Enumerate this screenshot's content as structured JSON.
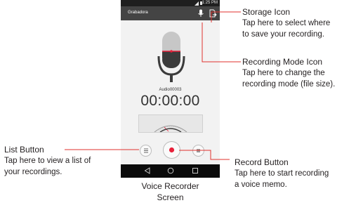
{
  "phone": {
    "status_time": "1:25 PM",
    "app_title": "Grabadora",
    "file_name": "Audio00003",
    "timer": "00:00:00"
  },
  "icons": {
    "storage": "storage-icon",
    "recording_mode": "microphone-icon",
    "list": "list-icon",
    "record": "record-icon",
    "stop": "stop-icon",
    "nav_back": "back-icon",
    "nav_home": "home-icon",
    "nav_recent": "recent-apps-icon"
  },
  "colors": {
    "leader_line": "#e0322e",
    "record_red": "#e8213a",
    "app_bar": "#444444"
  },
  "callouts": {
    "storage": {
      "title": "Storage Icon",
      "line1": "Tap here to select where",
      "line2": "to save your recording."
    },
    "recording_mode": {
      "title": "Recording Mode Icon",
      "line1": "Tap here to change the",
      "line2": "recording mode (file size)."
    },
    "list": {
      "title": "List Button",
      "line1": "Tap here to view a list of",
      "line2": "your recordings."
    },
    "record": {
      "title": "Record Button",
      "line1": "Tap here to start recording",
      "line2": "a voice memo."
    }
  },
  "caption": {
    "line1": "Voice Recorder",
    "line2": "Screen"
  }
}
